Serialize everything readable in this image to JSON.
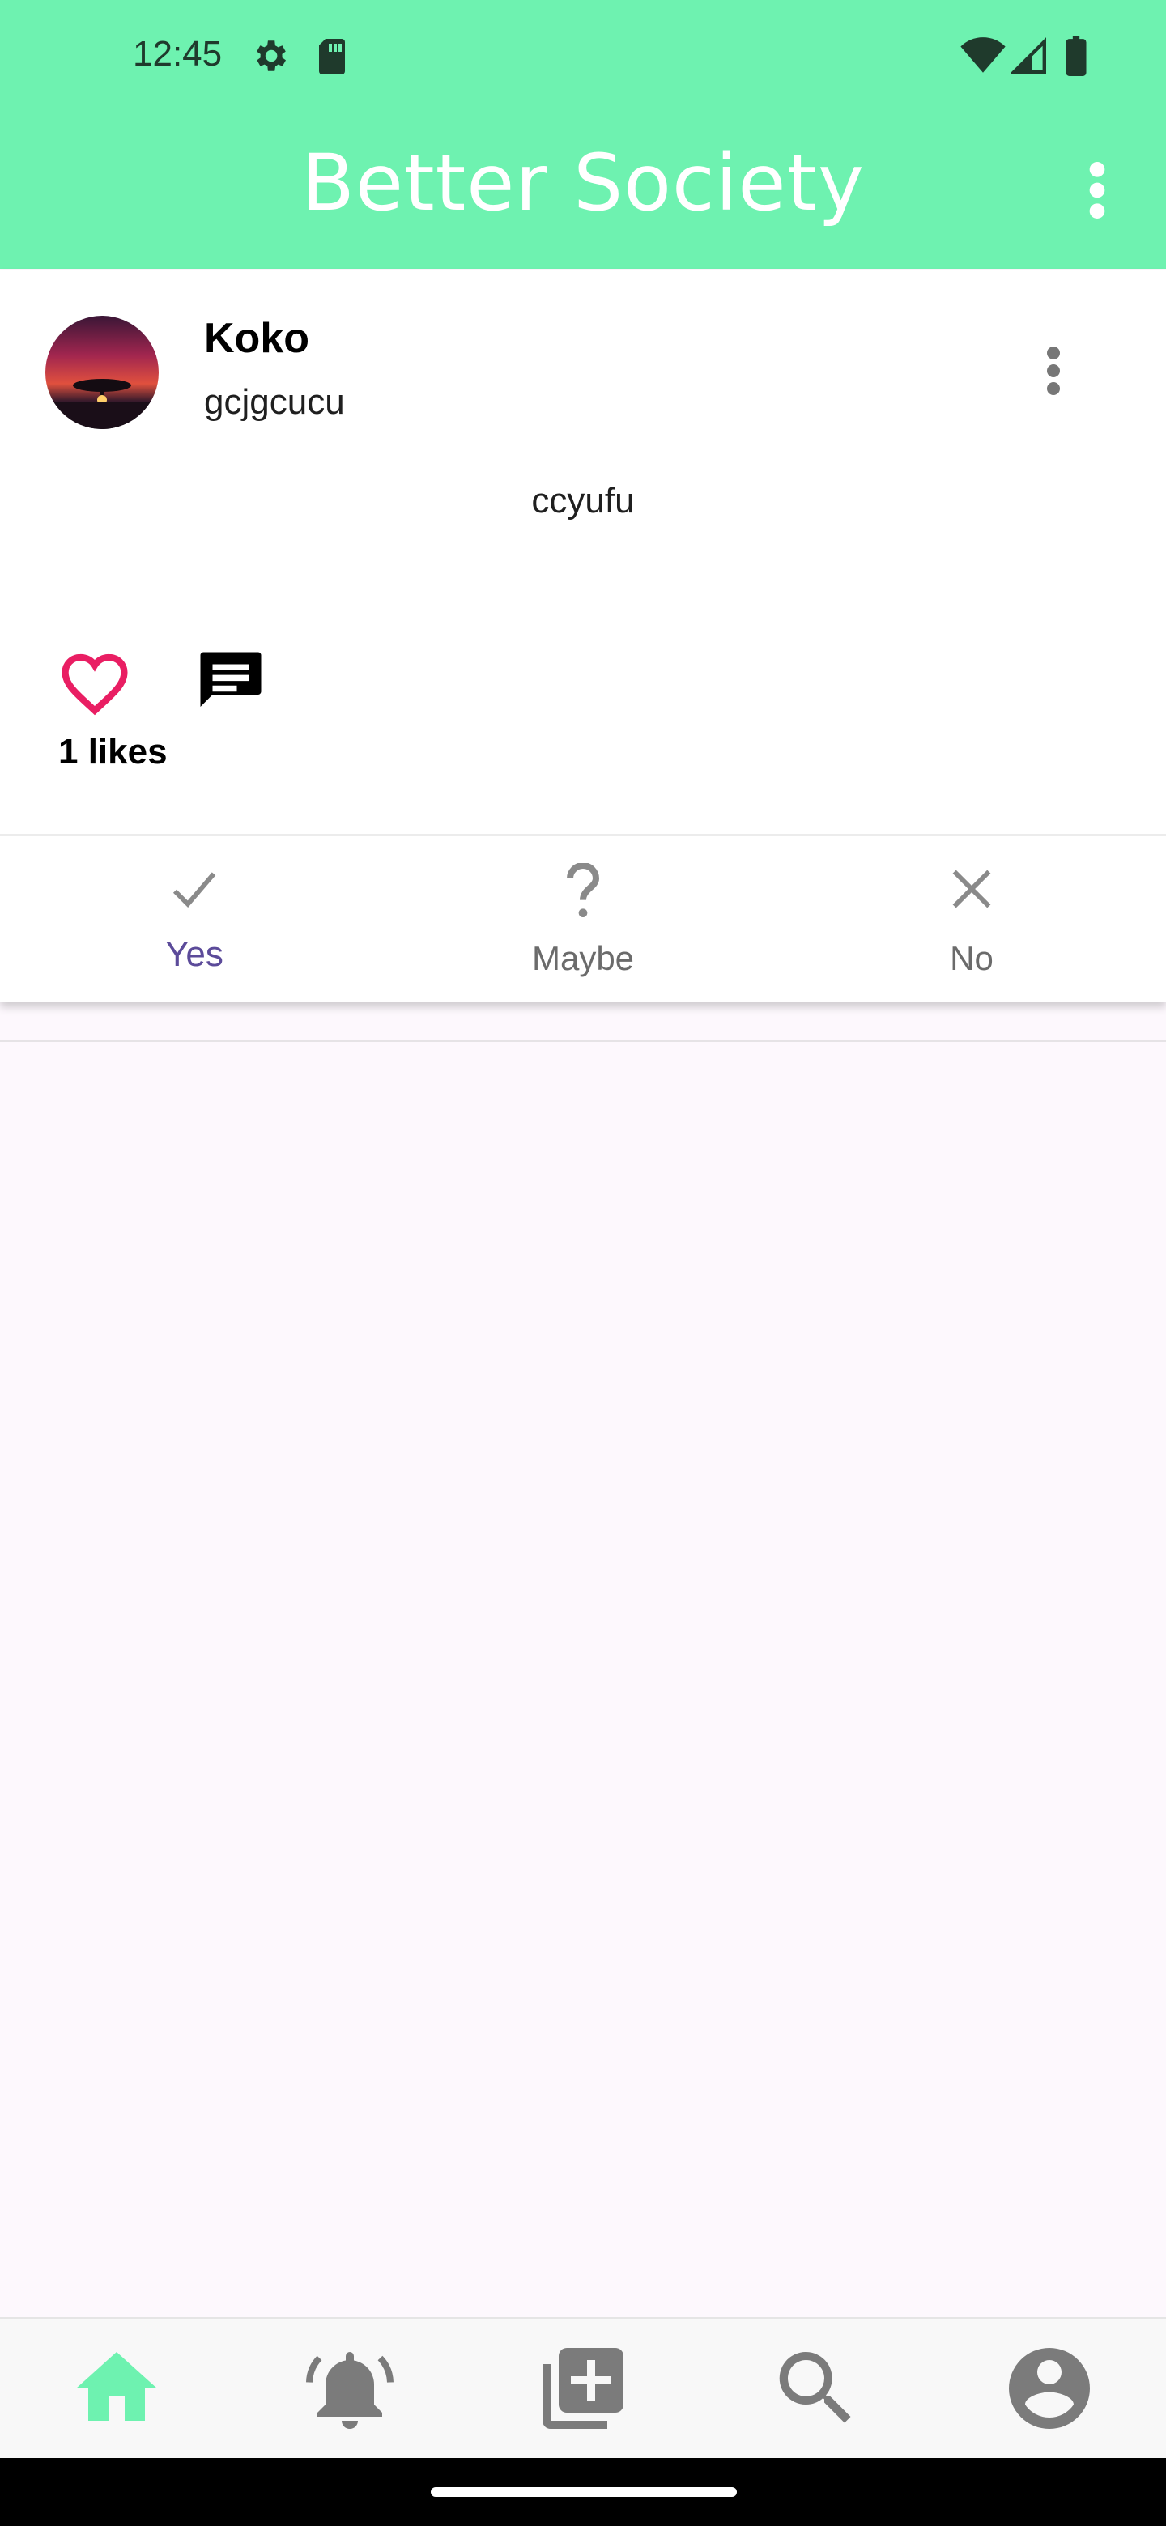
{
  "status_bar": {
    "time": "12:45",
    "icons": [
      "settings-icon",
      "sd-card-icon",
      "wifi-icon",
      "signal-icon",
      "battery-icon"
    ]
  },
  "app_bar": {
    "title": "Better Society",
    "menu_icon": "more-vert-icon"
  },
  "post": {
    "author_name": "Koko",
    "author_handle": "gcjgcucu",
    "body": "ccyufu",
    "likes_label": "1 likes",
    "like_color": "#e91e63"
  },
  "vote_bar": {
    "options": [
      {
        "label": "Yes",
        "icon": "check-icon",
        "selected": true
      },
      {
        "label": "Maybe",
        "icon": "question-icon",
        "selected": false
      },
      {
        "label": "No",
        "icon": "close-icon",
        "selected": false
      }
    ],
    "selected_color": "#5c4b9a"
  },
  "bottom_nav": {
    "items": [
      "home-icon",
      "notifications-icon",
      "add-post-icon",
      "search-icon",
      "profile-icon"
    ],
    "active": "home-icon",
    "active_color": "#6ef2b0"
  },
  "colors": {
    "accent": "#6ef2b0",
    "background": "#fdf8fd"
  }
}
